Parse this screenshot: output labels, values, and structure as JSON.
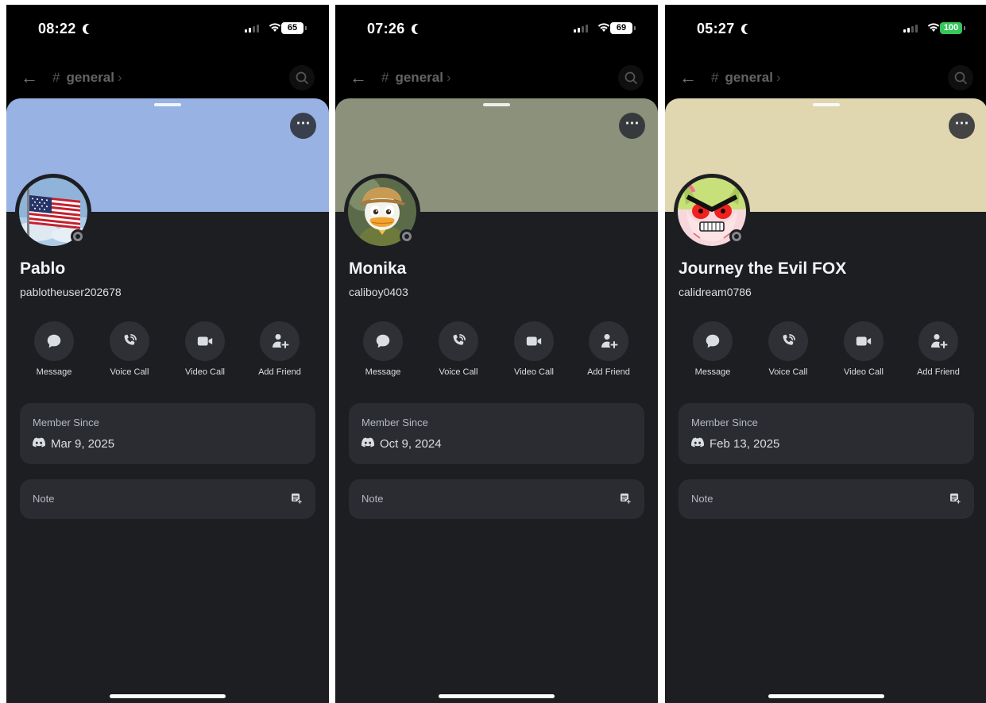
{
  "phones": [
    {
      "status": {
        "time": "08:22",
        "battery": "65"
      },
      "header": {
        "channel": "general"
      },
      "profile": {
        "display_name": "Pablo",
        "username": "pablotheuser202678",
        "banner_color": "#97b2e3",
        "avatar": "american-flag"
      },
      "actions": [
        {
          "label": "Message",
          "icon": "message-icon"
        },
        {
          "label": "Voice Call",
          "icon": "voice-call-icon"
        },
        {
          "label": "Video Call",
          "icon": "video-call-icon"
        },
        {
          "label": "Add Friend",
          "icon": "add-friend-icon"
        }
      ],
      "member_since": {
        "title": "Member Since",
        "date": "Mar 9, 2025"
      },
      "note": {
        "title": "Note"
      }
    },
    {
      "status": {
        "time": "07:26",
        "battery": "69"
      },
      "header": {
        "channel": "general"
      },
      "profile": {
        "display_name": "Monika",
        "username": "caliboy0403",
        "banner_color": "#8b917b",
        "avatar": "cartoon-duck"
      },
      "actions": [
        {
          "label": "Message",
          "icon": "message-icon"
        },
        {
          "label": "Voice Call",
          "icon": "voice-call-icon"
        },
        {
          "label": "Video Call",
          "icon": "video-call-icon"
        },
        {
          "label": "Add Friend",
          "icon": "add-friend-icon"
        }
      ],
      "member_since": {
        "title": "Member Since",
        "date": "Oct 9, 2024"
      },
      "note": {
        "title": "Note"
      }
    },
    {
      "status": {
        "time": "05:27",
        "battery": "100"
      },
      "header": {
        "channel": "general"
      },
      "profile": {
        "display_name": "Journey the Evil FOX",
        "username": "calidream0786",
        "banner_color": "#e0d6b0",
        "avatar": "angry-fox-cartoon"
      },
      "actions": [
        {
          "label": "Message",
          "icon": "message-icon"
        },
        {
          "label": "Voice Call",
          "icon": "voice-call-icon"
        },
        {
          "label": "Video Call",
          "icon": "video-call-icon"
        },
        {
          "label": "Add Friend",
          "icon": "add-friend-icon"
        }
      ],
      "member_since": {
        "title": "Member Since",
        "date": "Feb 13, 2025"
      },
      "note": {
        "title": "Note"
      }
    }
  ]
}
